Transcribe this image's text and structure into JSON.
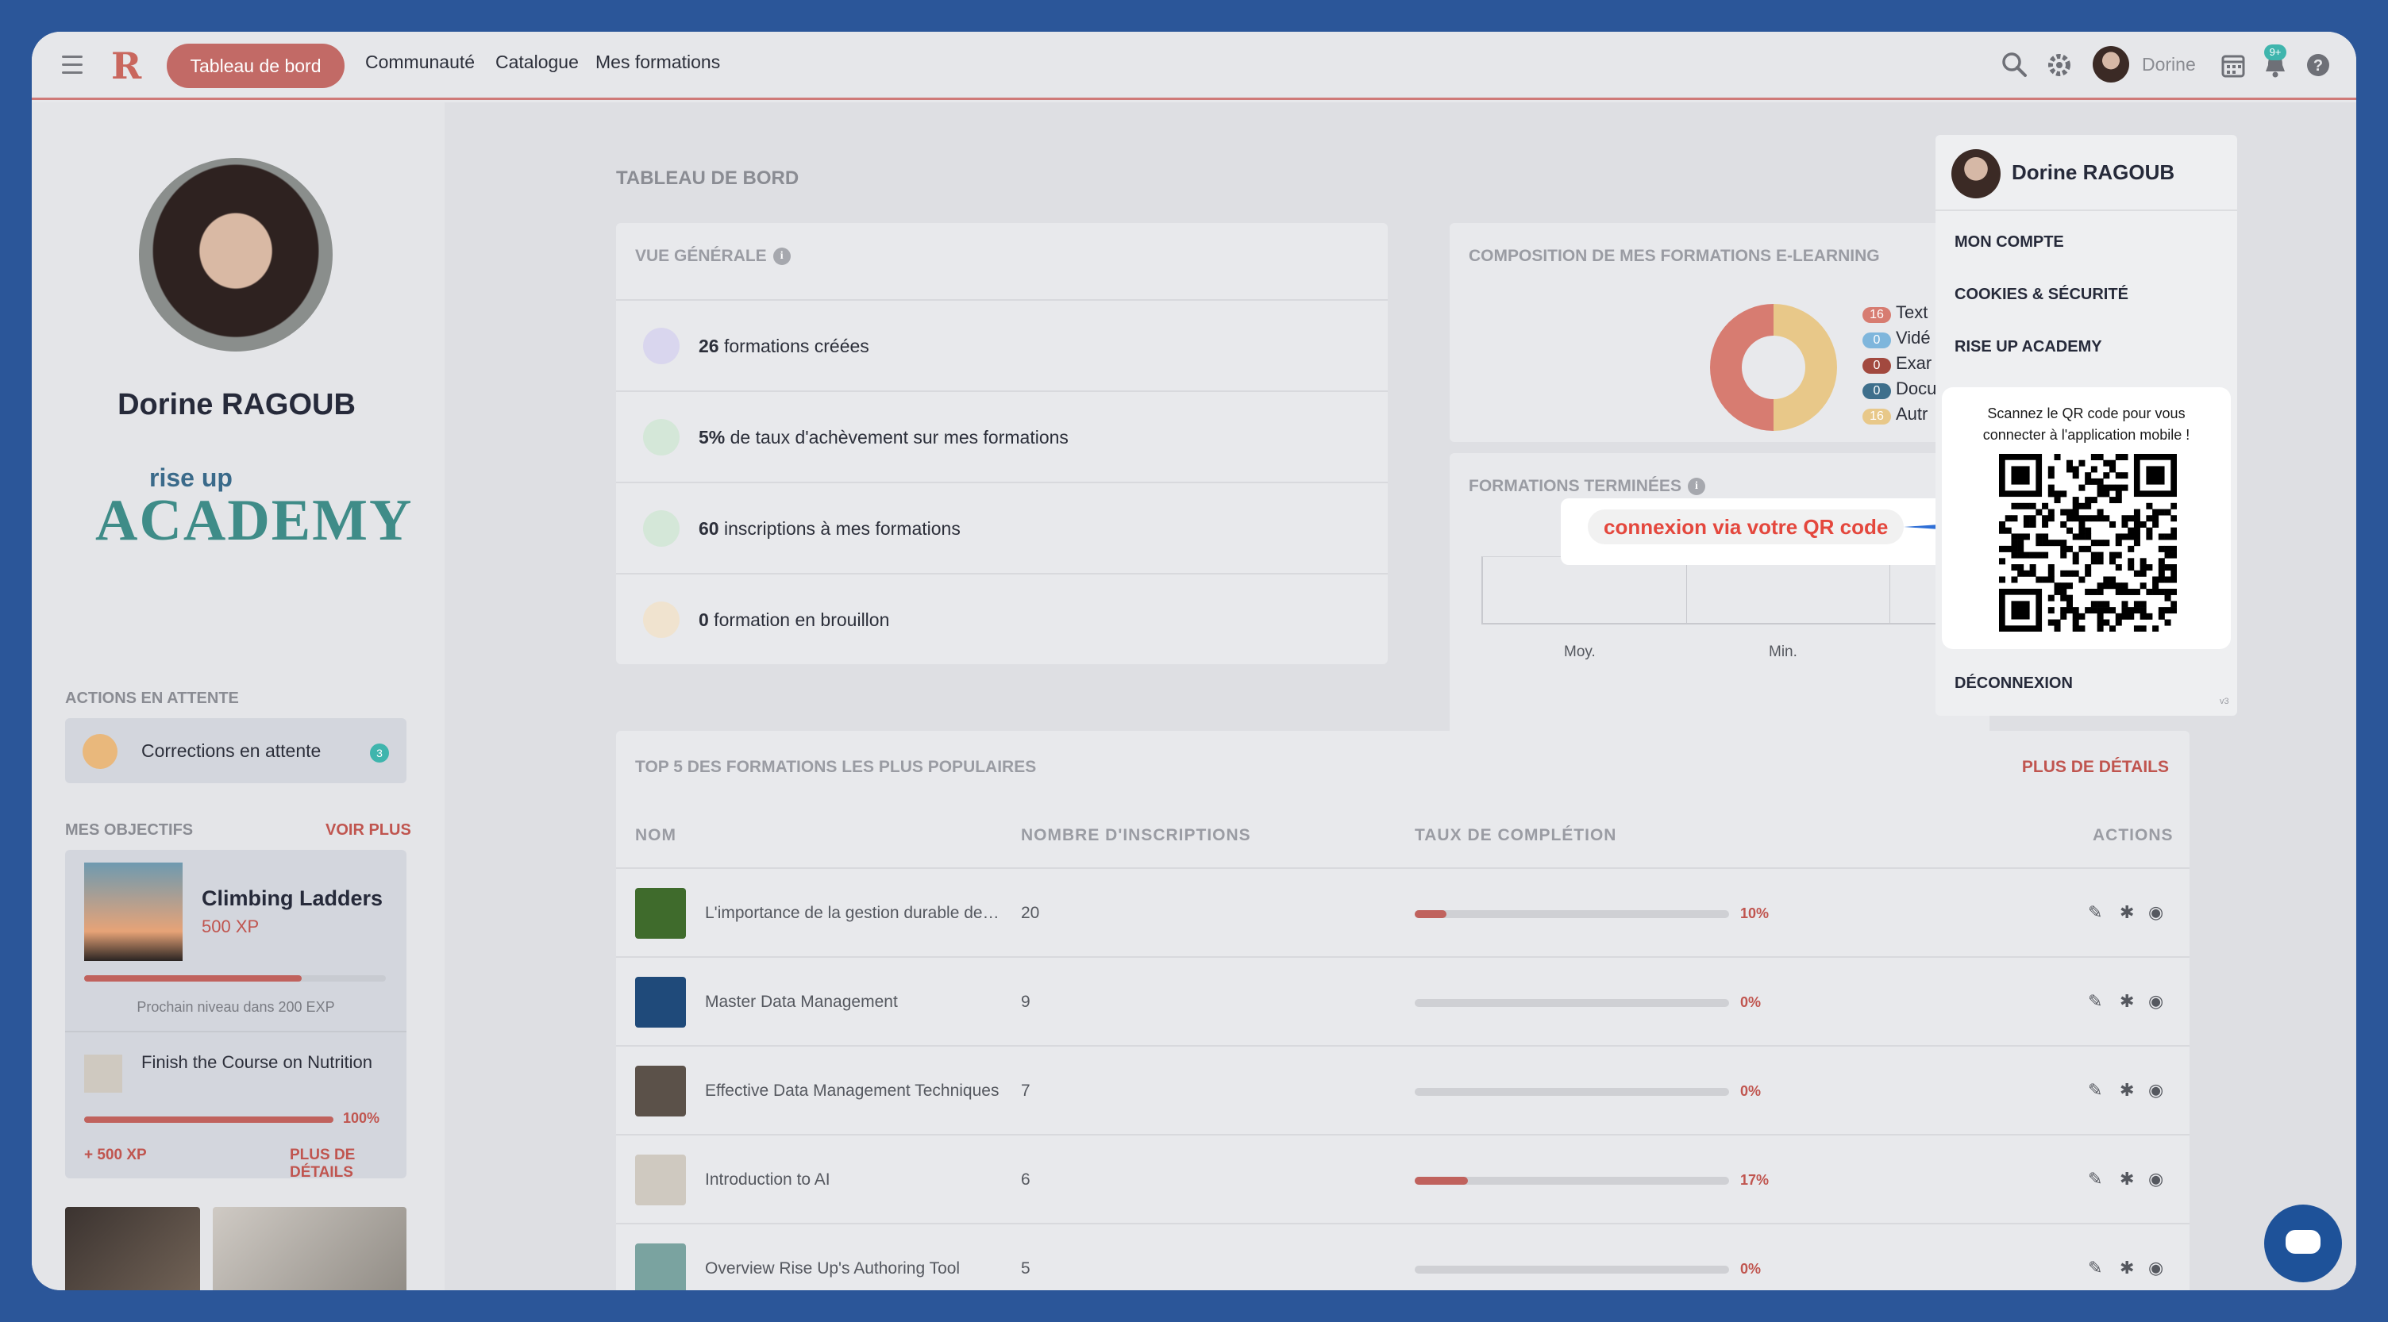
{
  "topbar": {
    "active_tab": "Tableau de bord",
    "nav": [
      "Communauté",
      "Catalogue",
      "Mes formations"
    ],
    "user_short": "Dorine",
    "notif_badge": "9+"
  },
  "sidebar": {
    "name": "Dorine RAGOUB",
    "logo_top": "rise up",
    "logo_main": "ACADEMY",
    "actions_title": "ACTIONS EN ATTENTE",
    "corrections_label": "Corrections en attente",
    "corrections_count": "3",
    "objectives_title": "MES OBJECTIFS",
    "voir_plus": "VOIR PLUS",
    "goal1_title": "Climbing Ladders",
    "goal1_xp": "500 XP",
    "goal1_progress": 0.72,
    "goal1_next": "Prochain niveau dans 200 EXP",
    "goal2_title": "Finish the Course on Nutrition",
    "goal2_pct": "100%",
    "goal2_progress": 1.0,
    "reward": "+ 500 XP",
    "details": "PLUS DE DÉTAILS"
  },
  "main": {
    "page_title": "TABLEAU DE BORD",
    "overview_title": "VUE GÉNÉRALE",
    "overview": [
      {
        "num": "26",
        "text": " formations créées",
        "color": "#d9d6ee"
      },
      {
        "num": "5%",
        "text": " de taux d'achèvement sur mes formations",
        "color": "#d4e7d8"
      },
      {
        "num": "60",
        "text": " inscriptions à mes formations",
        "color": "#d4e7d8"
      },
      {
        "num": "0",
        "text": " formation en brouillon",
        "color": "#f0e3cf"
      }
    ],
    "composition_title": "COMPOSITION DE MES FORMATIONS E-LEARNING",
    "legend": [
      {
        "count": "16",
        "label": "Text",
        "color": "#d77c71"
      },
      {
        "count": "0",
        "label": "Vidé",
        "color": "#7fb6dc"
      },
      {
        "count": "0",
        "label": "Exar",
        "color": "#a2493f"
      },
      {
        "count": "0",
        "label": "Docu",
        "color": "#3e6f8c"
      },
      {
        "count": "16",
        "label": "Autr",
        "color": "#e8c889"
      }
    ],
    "finished_title": "FORMATIONS TERMINÉES",
    "finished_labels": [
      "Moy.",
      "Min."
    ],
    "tooltip": "connexion via votre QR code"
  },
  "dropdown": {
    "name": "Dorine RAGOUB",
    "items": [
      "MON COMPTE",
      "COOKIES & SÉCURITÉ",
      "RISE UP ACADEMY"
    ],
    "qr_caption_1": "Scannez le QR code pour vous",
    "qr_caption_2": "connecter à l'application mobile !",
    "logout": "DÉCONNEXION",
    "version": "v3"
  },
  "top5": {
    "title": "TOP 5 DES FORMATIONS LES PLUS POPULAIRES",
    "more": "PLUS DE DÉTAILS",
    "headers": [
      "NOM",
      "NOMBRE D'INSCRIPTIONS",
      "TAUX DE COMPLÉTION",
      "ACTIONS"
    ],
    "rows": [
      {
        "name": "L'importance de la gestion durable de ...",
        "count": "20",
        "pct": "10%",
        "value": 0.1,
        "thumb": "#3f6b2c"
      },
      {
        "name": "Master Data Management",
        "count": "9",
        "pct": "0%",
        "value": 0,
        "thumb": "#1f4a7a"
      },
      {
        "name": "Effective Data Management Techniques",
        "count": "7",
        "pct": "0%",
        "value": 0,
        "thumb": "#5b5149"
      },
      {
        "name": "Introduction to AI",
        "count": "6",
        "pct": "17%",
        "value": 0.17,
        "thumb": "#cfc9c0"
      },
      {
        "name": "Overview Rise Up's Authoring Tool",
        "count": "5",
        "pct": "0%",
        "value": 0,
        "thumb": "#7aa3a0"
      }
    ]
  }
}
